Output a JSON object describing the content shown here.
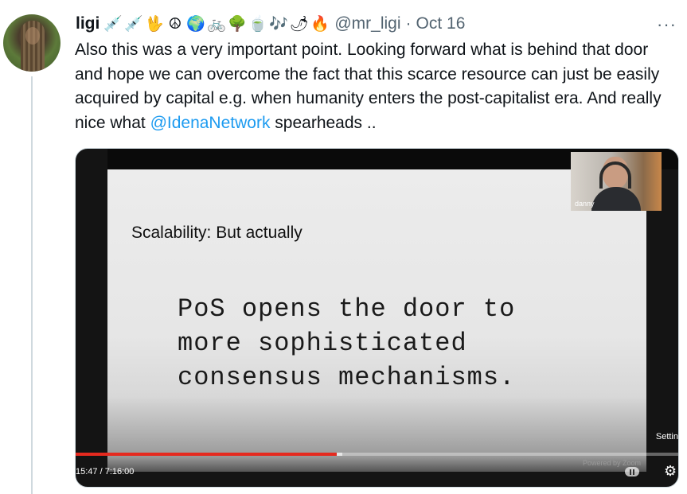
{
  "author": {
    "name": "ligi",
    "emojis": [
      "💉",
      "💉",
      "🖖",
      "☮",
      "🌍",
      "🚲",
      "🌳",
      "🍵",
      "🎶",
      "🌶",
      "🔥"
    ],
    "handle": "@mr_ligi",
    "separator": "·",
    "date": "Oct 16"
  },
  "more_label": "···",
  "tweet": {
    "text_before": "Also this was a very important point. Looking forward what is behind that door and hope we can overcome the fact that this scarce resource can just be easily acquired by capital e.g. when humanity enters the post-capitalist era. And really nice what ",
    "mention": "@IdenaNetwork",
    "text_after": " spearheads .."
  },
  "video": {
    "slide_title": "Scalability: But actually",
    "slide_body": "PoS opens the door to\nmore sophisticated\nconsensus mechanisms.",
    "camera_name": "danny",
    "settings_label": "Settin",
    "time": "15:47 / 7:16:00",
    "powered_by": "Powered by Zoom",
    "progress_fraction": 0.4316,
    "buffered_fraction": 0.441,
    "progress_color": "#e52a1f"
  },
  "colors": {
    "link": "#1d9bf0",
    "secondary_text": "#536471"
  }
}
